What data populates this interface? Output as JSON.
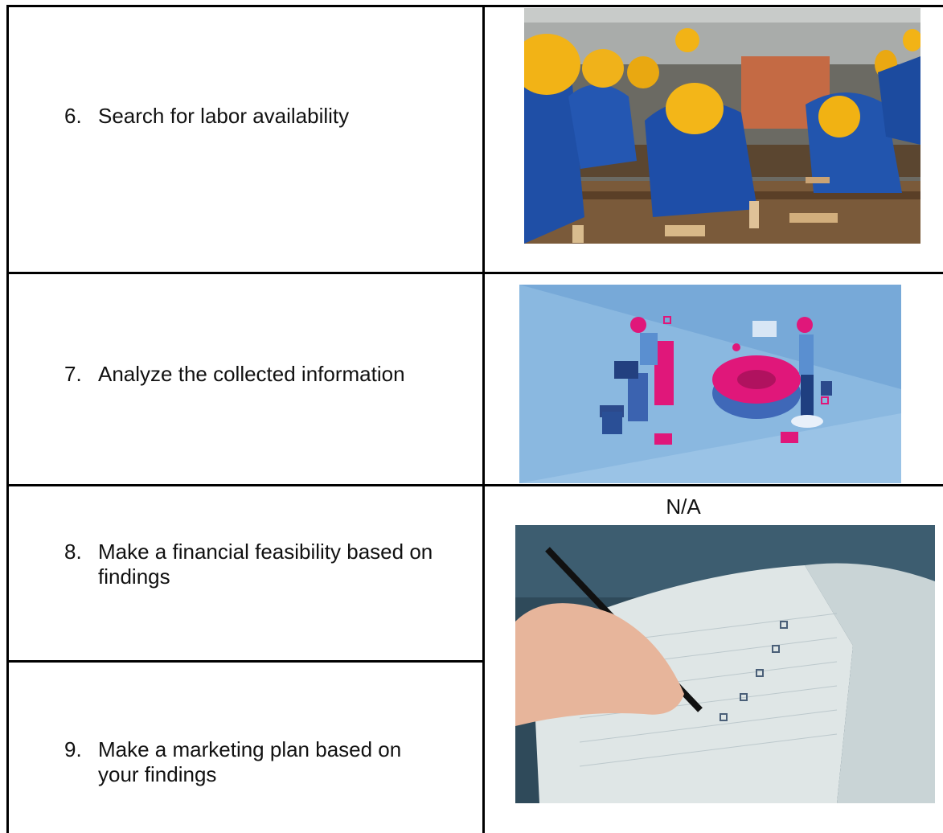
{
  "rows": [
    {
      "number": "6.",
      "text": "Search for labor availability"
    },
    {
      "number": "7.",
      "text": "Analyze the collected information"
    },
    {
      "number": "8.",
      "text": "Make a financial feasibility based on findings"
    },
    {
      "number": "9.",
      "text": "Make a marketing plan based on your findings"
    }
  ],
  "na_label": "N/A",
  "images": [
    {
      "icon": "workers-woodshop-photo"
    },
    {
      "icon": "data-analysis-illustration"
    },
    {
      "icon": "writing-checklist-photo"
    }
  ],
  "colors": {
    "border": "#000000",
    "illustration_bg": "#7fb3de",
    "accent_pink": "#e0177a"
  }
}
